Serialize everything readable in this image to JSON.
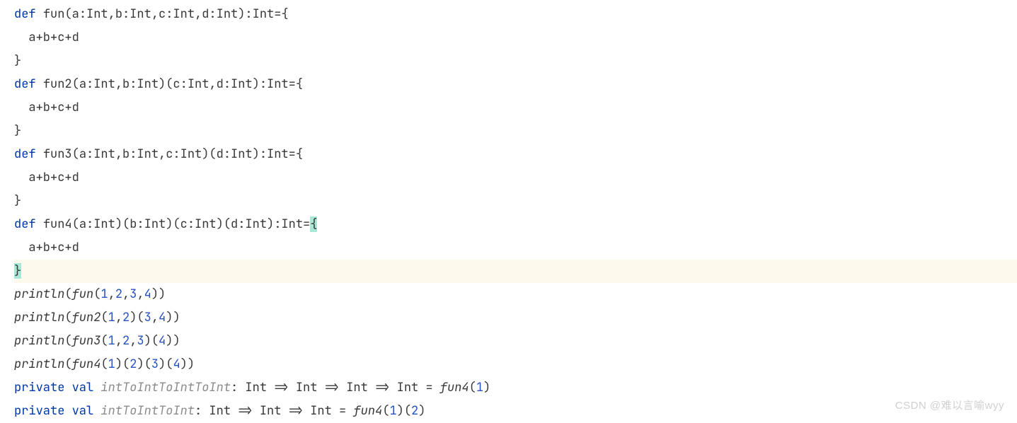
{
  "code": {
    "l1": {
      "def": "def",
      "name": "fun",
      "sig": "(a:Int,b:Int,c:Int,d:Int):Int={"
    },
    "l2": "  a+b+c+d",
    "l3": "}",
    "l4": {
      "def": "def",
      "name": "fun2",
      "sig": "(a:Int,b:Int)(c:Int,d:Int):Int={"
    },
    "l5": "  a+b+c+d",
    "l6": "}",
    "l7": {
      "def": "def",
      "name": "fun3",
      "sig": "(a:Int,b:Int,c:Int)(d:Int):Int={"
    },
    "l8": "  a+b+c+d",
    "l9": "}",
    "l10": {
      "def": "def",
      "name": "fun4",
      "sig_a": "(a:Int)(b:Int)(c:Int)(d:Int):Int=",
      "brace": "{"
    },
    "l11": "  a+b+c+d",
    "l12": "}",
    "l13": {
      "fn": "println",
      "open": "(",
      "call": "fun",
      "p": "(",
      "n1": "1",
      "c1": ",",
      "n2": "2",
      "c2": ",",
      "n3": "3",
      "c3": ",",
      "n4": "4",
      "cl": "))"
    },
    "l14": {
      "fn": "println",
      "open": "(",
      "call": "fun2",
      "p": "(",
      "n1": "1",
      "c1": ",",
      "n2": "2",
      "m1": ")(",
      "n3": "3",
      "c3": ",",
      "n4": "4",
      "cl": "))"
    },
    "l15": {
      "fn": "println",
      "open": "(",
      "call": "fun3",
      "p": "(",
      "n1": "1",
      "c1": ",",
      "n2": "2",
      "c2": ",",
      "n3": "3",
      "m1": ")(",
      "n4": "4",
      "cl": "))"
    },
    "l16": {
      "fn": "println",
      "open": "(",
      "call": "fun4",
      "p": "(",
      "n1": "1",
      "m1": ")(",
      "n2": "2",
      "m2": ")(",
      "n3": "3",
      "m3": ")(",
      "n4": "4",
      "cl": "))"
    },
    "l17": {
      "priv": "private val",
      "sp": " ",
      "name": "intToIntToIntToInt",
      "rest": ": Int => Int => Int => Int = ",
      "call": "fun4",
      "p": "(",
      "n1": "1",
      "cl": ")"
    },
    "l18": {
      "priv": "private val",
      "sp": " ",
      "name": "intToIntToInt",
      "rest": ": Int => Int => Int = ",
      "call": "fun4",
      "p": "(",
      "n1": "1",
      "m1": ")(",
      "n2": "2",
      "cl": ")"
    }
  },
  "watermark": "CSDN @难以言喻wyy"
}
